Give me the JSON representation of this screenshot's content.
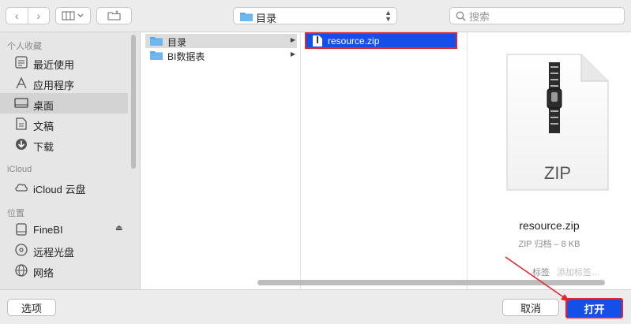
{
  "toolbar": {
    "back": "‹",
    "forward": "›",
    "path_label": "目录",
    "search_placeholder": "搜索"
  },
  "sidebar": {
    "section_favorites": "个人收藏",
    "section_icloud": "iCloud",
    "section_locations": "位置",
    "favorites": [
      {
        "label": "最近使用",
        "icon": "clock-icon"
      },
      {
        "label": "应用程序",
        "icon": "applications-icon"
      },
      {
        "label": "桌面",
        "icon": "desktop-icon",
        "selected": true
      },
      {
        "label": "文稿",
        "icon": "document-icon"
      },
      {
        "label": "下载",
        "icon": "download-icon"
      }
    ],
    "icloud": [
      {
        "label": "iCloud 云盘",
        "icon": "cloud-icon"
      }
    ],
    "locations": [
      {
        "label": "FineBI",
        "icon": "drive-icon"
      },
      {
        "label": "远程光盘",
        "icon": "disc-icon"
      },
      {
        "label": "网络",
        "icon": "network-icon"
      }
    ],
    "eject": "⏏"
  },
  "column1": [
    {
      "label": "目录",
      "selected": true
    },
    {
      "label": "BI数据表",
      "selected": false
    }
  ],
  "column2": [
    {
      "label": "resource.zip"
    }
  ],
  "preview": {
    "icon_label": "ZIP",
    "name": "resource.zip",
    "meta": "ZIP 归档 – 8 KB",
    "tags_label": "标签",
    "tags_placeholder": "添加标签…"
  },
  "bottom": {
    "options": "选项",
    "cancel": "取消",
    "open": "打开"
  },
  "colors": {
    "selection_blue": "#1450e8",
    "annotation_red": "#e0262e",
    "folder_blue": "#5aa9e6"
  }
}
